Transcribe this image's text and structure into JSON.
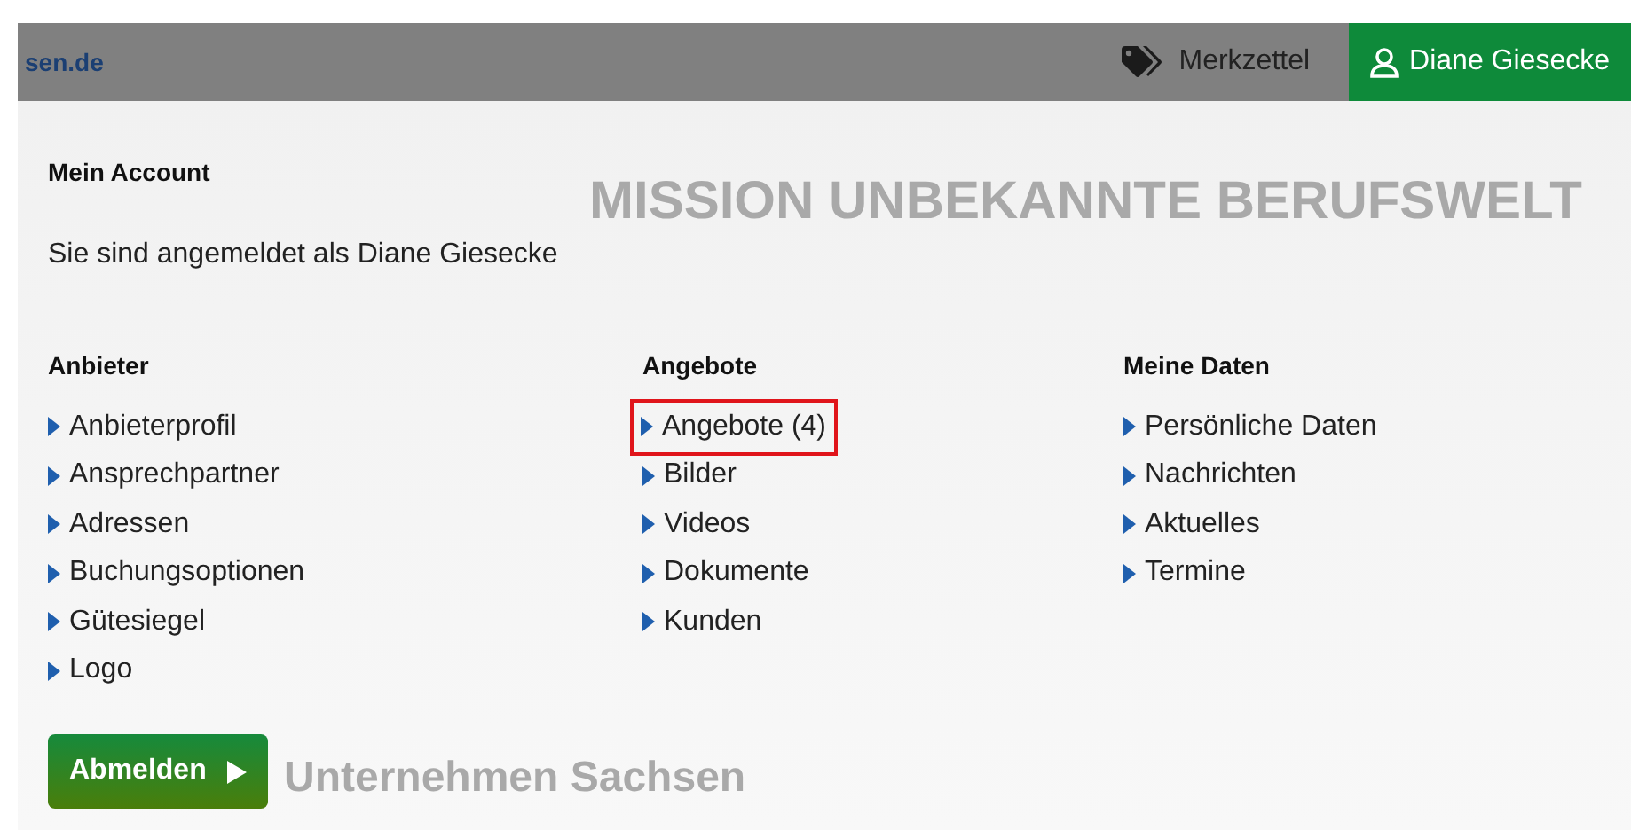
{
  "topbar": {
    "site": "sen.de",
    "watchlist": "Merkzettel",
    "user": "Diane Giesecke"
  },
  "background": {
    "banner_title": "MISSION UNBEKANNTE BERUFSWELT",
    "footer_text": "Unternehmen Sachsen"
  },
  "account": {
    "title": "Mein Account",
    "status": "Sie sind angemeldet als Diane Giesecke",
    "columns": [
      {
        "heading": "Anbieter",
        "items": [
          {
            "label": "Anbieterprofil",
            "highlighted": false
          },
          {
            "label": "Ansprechpartner",
            "highlighted": false
          },
          {
            "label": "Adressen",
            "highlighted": false
          },
          {
            "label": "Buchungsoptionen",
            "highlighted": false
          },
          {
            "label": "Gütesiegel",
            "highlighted": false
          },
          {
            "label": "Logo",
            "highlighted": false
          }
        ]
      },
      {
        "heading": "Angebote",
        "items": [
          {
            "label": "Angebote (4)",
            "highlighted": true
          },
          {
            "label": "Bilder",
            "highlighted": false
          },
          {
            "label": "Videos",
            "highlighted": false
          },
          {
            "label": "Dokumente",
            "highlighted": false
          },
          {
            "label": "Kunden",
            "highlighted": false
          }
        ]
      },
      {
        "heading": "Meine Daten",
        "items": [
          {
            "label": "Persönliche Daten",
            "highlighted": false
          },
          {
            "label": "Nachrichten",
            "highlighted": false
          },
          {
            "label": "Aktuelles",
            "highlighted": false
          },
          {
            "label": "Termine",
            "highlighted": false
          }
        ]
      }
    ],
    "logout": "Abmelden"
  }
}
